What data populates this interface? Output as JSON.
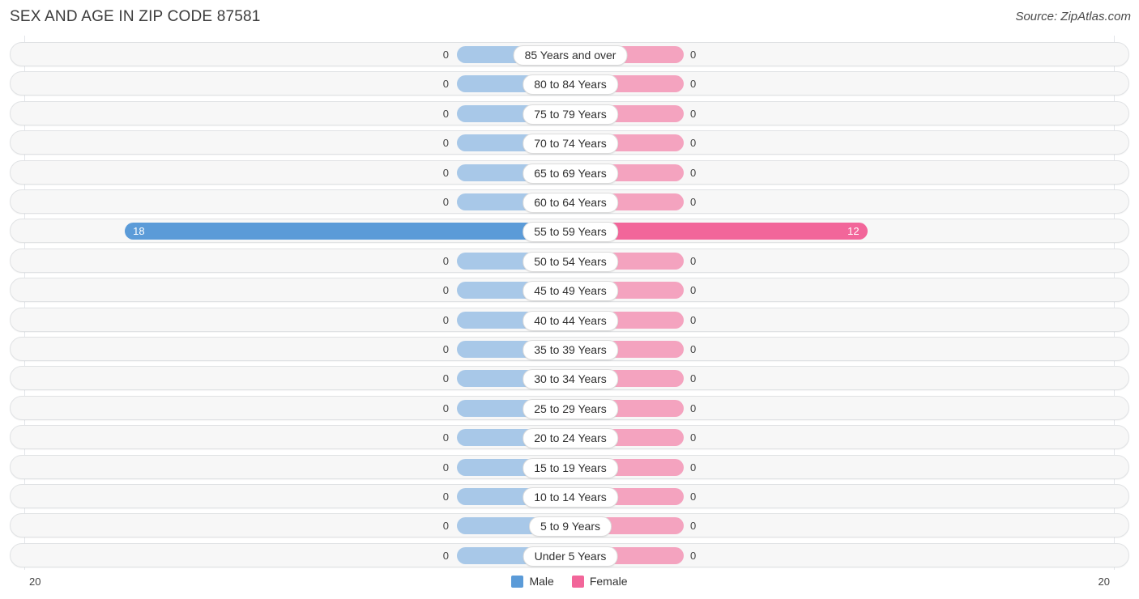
{
  "header": {
    "title": "SEX AND AGE IN ZIP CODE 87581",
    "source": "Source: ZipAtlas.com"
  },
  "legend": {
    "male_label": "Male",
    "female_label": "Female",
    "male_color": "#5b9bd8",
    "female_color": "#f2669a"
  },
  "axis": {
    "left_max_label": "20",
    "right_max_label": "20"
  },
  "chart_data": {
    "type": "bar",
    "title": "SEX AND AGE IN ZIP CODE 87581",
    "subtitle": "Source: ZipAtlas.com",
    "orientation": "horizontal-diverging",
    "xlabel": "",
    "ylabel": "",
    "xlim": [
      20,
      20
    ],
    "grid": true,
    "legend_position": "bottom-center",
    "categories": [
      "85 Years and over",
      "80 to 84 Years",
      "75 to 79 Years",
      "70 to 74 Years",
      "65 to 69 Years",
      "60 to 64 Years",
      "55 to 59 Years",
      "50 to 54 Years",
      "45 to 49 Years",
      "40 to 44 Years",
      "35 to 39 Years",
      "30 to 34 Years",
      "25 to 29 Years",
      "20 to 24 Years",
      "15 to 19 Years",
      "10 to 14 Years",
      "5 to 9 Years",
      "Under 5 Years"
    ],
    "series": [
      {
        "name": "Male",
        "color": "#5b9bd8",
        "values": [
          0,
          0,
          0,
          0,
          0,
          0,
          18,
          0,
          0,
          0,
          0,
          0,
          0,
          0,
          0,
          0,
          0,
          0
        ],
        "labels": [
          "0",
          "0",
          "0",
          "0",
          "0",
          "0",
          "18",
          "0",
          "0",
          "0",
          "0",
          "0",
          "0",
          "0",
          "0",
          "0",
          "0",
          "0"
        ]
      },
      {
        "name": "Female",
        "color": "#f2669a",
        "values": [
          0,
          0,
          0,
          0,
          0,
          0,
          12,
          0,
          0,
          0,
          0,
          0,
          0,
          0,
          0,
          0,
          0,
          0
        ],
        "labels": [
          "0",
          "0",
          "0",
          "0",
          "0",
          "0",
          "12",
          "0",
          "0",
          "0",
          "0",
          "0",
          "0",
          "0",
          "0",
          "0",
          "0",
          "0"
        ]
      }
    ]
  }
}
